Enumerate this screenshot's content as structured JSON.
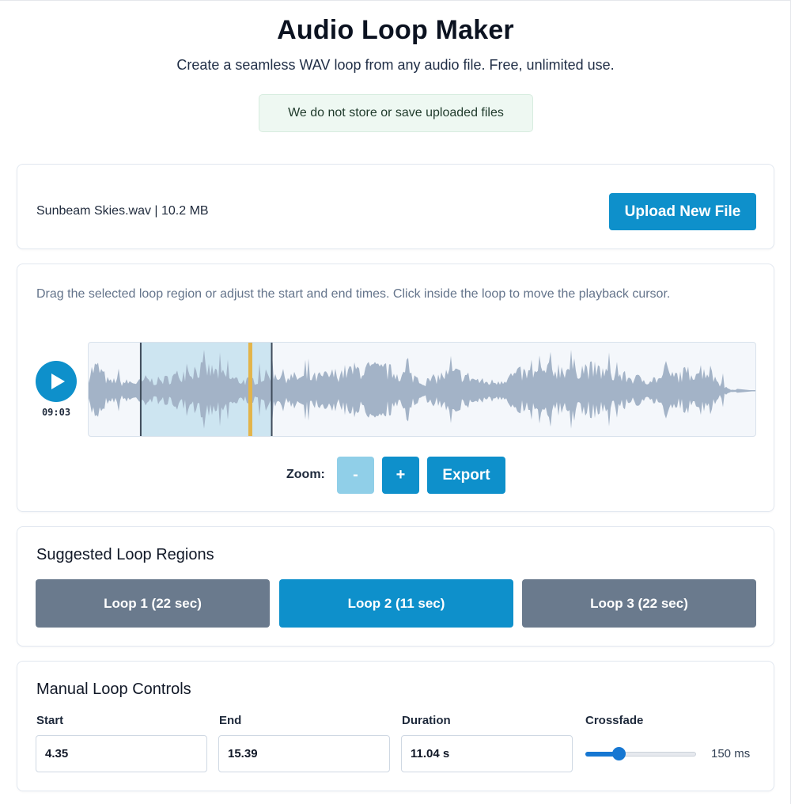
{
  "colors": {
    "accent": "#0e90cb",
    "accent_disabled": "#90cfe8",
    "loop_inactive": "#6a7a8d",
    "waveform": "#a3b3c7",
    "selection": "#c5e2ef",
    "playhead": "#e3b449"
  },
  "header": {
    "title": "Audio Loop Maker",
    "subtitle": "Create a seamless WAV loop from any audio file. Free, unlimited use.",
    "privacy_note": "We do not store or save uploaded files"
  },
  "file": {
    "info": "Sunbeam Skies.wav | 10.2 MB",
    "upload_label": "Upload New File"
  },
  "editor": {
    "instructions": "Drag the selected loop region or adjust the start and end times. Click inside the loop to move the playback cursor.",
    "play_icon": "play-icon",
    "time": "09:03",
    "zoom_label": "Zoom:",
    "zoom_out": "-",
    "zoom_in": "+",
    "export_label": "Export",
    "loop_start_fraction": 0.078,
    "loop_end_fraction": 0.274,
    "playhead_fraction": 0.239
  },
  "suggested": {
    "title": "Suggested Loop Regions",
    "loops": [
      {
        "label": "Loop 1 (22 sec)",
        "active": false
      },
      {
        "label": "Loop 2 (11 sec)",
        "active": true
      },
      {
        "label": "Loop 3 (22 sec)",
        "active": false
      }
    ]
  },
  "manual": {
    "title": "Manual Loop Controls",
    "start_label": "Start",
    "start_value": "4.35",
    "end_label": "End",
    "end_value": "15.39",
    "duration_label": "Duration",
    "duration_value": "11.04 s",
    "crossfade_label": "Crossfade",
    "crossfade_value": "150 ms",
    "crossfade_fraction": 0.3
  }
}
